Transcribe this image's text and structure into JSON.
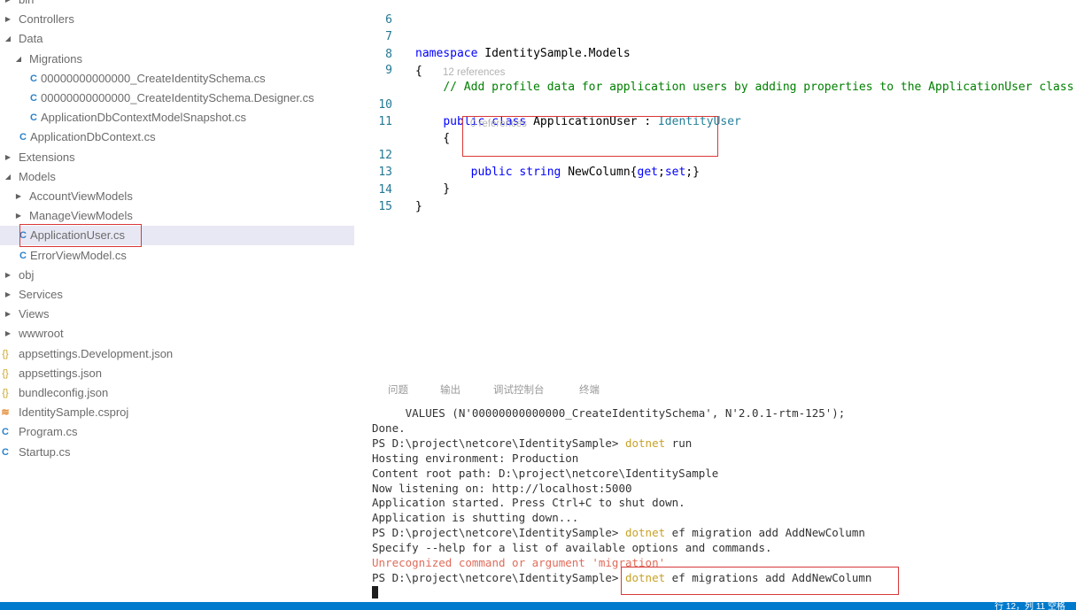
{
  "explorer": {
    "items": [
      {
        "label": "bin",
        "arrow": "▶",
        "icon": ""
      },
      {
        "label": "Controllers",
        "arrow": "▶",
        "icon": ""
      },
      {
        "label": "Data",
        "arrow": "◢",
        "icon": ""
      },
      {
        "label": "Migrations",
        "arrow": "◢",
        "icon": ""
      },
      {
        "label": "00000000000000_CreateIdentitySchema.cs",
        "arrow": "",
        "icon": "C#"
      },
      {
        "label": "00000000000000_CreateIdentitySchema.Designer.cs",
        "arrow": "",
        "icon": "C#"
      },
      {
        "label": "ApplicationDbContextModelSnapshot.cs",
        "arrow": "",
        "icon": "C#"
      },
      {
        "label": "ApplicationDbContext.cs",
        "arrow": "",
        "icon": "C#"
      },
      {
        "label": "Extensions",
        "arrow": "▶",
        "icon": ""
      },
      {
        "label": "Models",
        "arrow": "◢",
        "icon": ""
      },
      {
        "label": "AccountViewModels",
        "arrow": "▶",
        "icon": ""
      },
      {
        "label": "ManageViewModels",
        "arrow": "▶",
        "icon": ""
      },
      {
        "label": "ApplicationUser.cs",
        "arrow": "",
        "icon": "C#"
      },
      {
        "label": "ErrorViewModel.cs",
        "arrow": "",
        "icon": "C#"
      },
      {
        "label": "obj",
        "arrow": "▶",
        "icon": ""
      },
      {
        "label": "Services",
        "arrow": "▶",
        "icon": ""
      },
      {
        "label": "Views",
        "arrow": "▶",
        "icon": ""
      },
      {
        "label": "wwwroot",
        "arrow": "▶",
        "icon": ""
      },
      {
        "label": "appsettings.Development.json",
        "arrow": "",
        "icon": "{}"
      },
      {
        "label": "appsettings.json",
        "arrow": "",
        "icon": "{}"
      },
      {
        "label": "bundleconfig.json",
        "arrow": "",
        "icon": "{}"
      },
      {
        "label": "IdentitySample.csproj",
        "arrow": "",
        "icon": "≋"
      },
      {
        "label": "Program.cs",
        "arrow": "",
        "icon": "C#"
      },
      {
        "label": "Startup.cs",
        "arrow": "",
        "icon": "C#"
      }
    ]
  },
  "editor": {
    "lines": [
      {
        "num": "6",
        "text": ""
      },
      {
        "num": "7",
        "text": "namespace IdentitySample.Models"
      },
      {
        "num": "8",
        "text": "{"
      },
      {
        "num": "9",
        "text": "    // Add profile data for application users by adding properties to the ApplicationUser class"
      },
      {
        "num": "10",
        "text": "    public class ApplicationUser : IdentityUser"
      },
      {
        "num": "11",
        "text": "    {"
      },
      {
        "num": "12",
        "text": "        public string NewColumn{get;set;}"
      },
      {
        "num": "13",
        "text": "    }"
      },
      {
        "num": "14",
        "text": "}"
      },
      {
        "num": "15",
        "text": ""
      }
    ],
    "codelens_class": "12 references",
    "codelens_prop": "0 references",
    "tokens": {
      "namespace": "namespace",
      "ns_name": "IdentitySample.Models",
      "comment": "// Add profile data for application users by adding properties to the ApplicationUser class",
      "public": "public",
      "class": "class",
      "class_name": "ApplicationUser",
      "colon": ":",
      "base": "IdentityUser",
      "string": "string",
      "prop": "NewColumn",
      "get": "get",
      "set": "set"
    }
  },
  "panel": {
    "tabs": [
      "问题",
      "输出",
      "调试控制台",
      "终端"
    ]
  },
  "terminal": {
    "lines": [
      {
        "text": "     VALUES (N'00000000000000_CreateIdentitySchema', N'2.0.1-rtm-125');",
        "kind": "plain"
      },
      {
        "text": "Done.",
        "kind": "plain"
      },
      {
        "prompt": "PS D:\\project\\netcore\\IdentitySample> ",
        "cmd": "dotnet",
        "args": " run",
        "kind": "prompt"
      },
      {
        "text": "Hosting environment: Production",
        "kind": "plain"
      },
      {
        "text": "Content root path: D:\\project\\netcore\\IdentitySample",
        "kind": "plain"
      },
      {
        "text": "Now listening on: http://localhost:5000",
        "kind": "plain"
      },
      {
        "text": "Application started. Press Ctrl+C to shut down.",
        "kind": "plain"
      },
      {
        "text": "Application is shutting down...",
        "kind": "plain"
      },
      {
        "prompt": "PS D:\\project\\netcore\\IdentitySample> ",
        "cmd": "dotnet",
        "args": " ef migration add AddNewColumn",
        "kind": "prompt"
      },
      {
        "text": "Specify --help for a list of available options and commands.",
        "kind": "plain"
      },
      {
        "text": "Unrecognized command or argument 'migration'",
        "kind": "error"
      },
      {
        "prompt": "PS D:\\project\\netcore\\IdentitySample> ",
        "cmd": "dotnet",
        "args": " ef migrations add AddNewColumn",
        "kind": "prompt"
      }
    ]
  },
  "statusbar": {
    "right": "行 12，列 11   空格"
  },
  "colors": {
    "status_bar": "#007acc",
    "highlight_box": "#d93838",
    "keyword": "#0000ff",
    "type": "#267f99",
    "comment": "#008000",
    "terminal_command": "#c9a227",
    "terminal_error": "#e06c5a"
  }
}
